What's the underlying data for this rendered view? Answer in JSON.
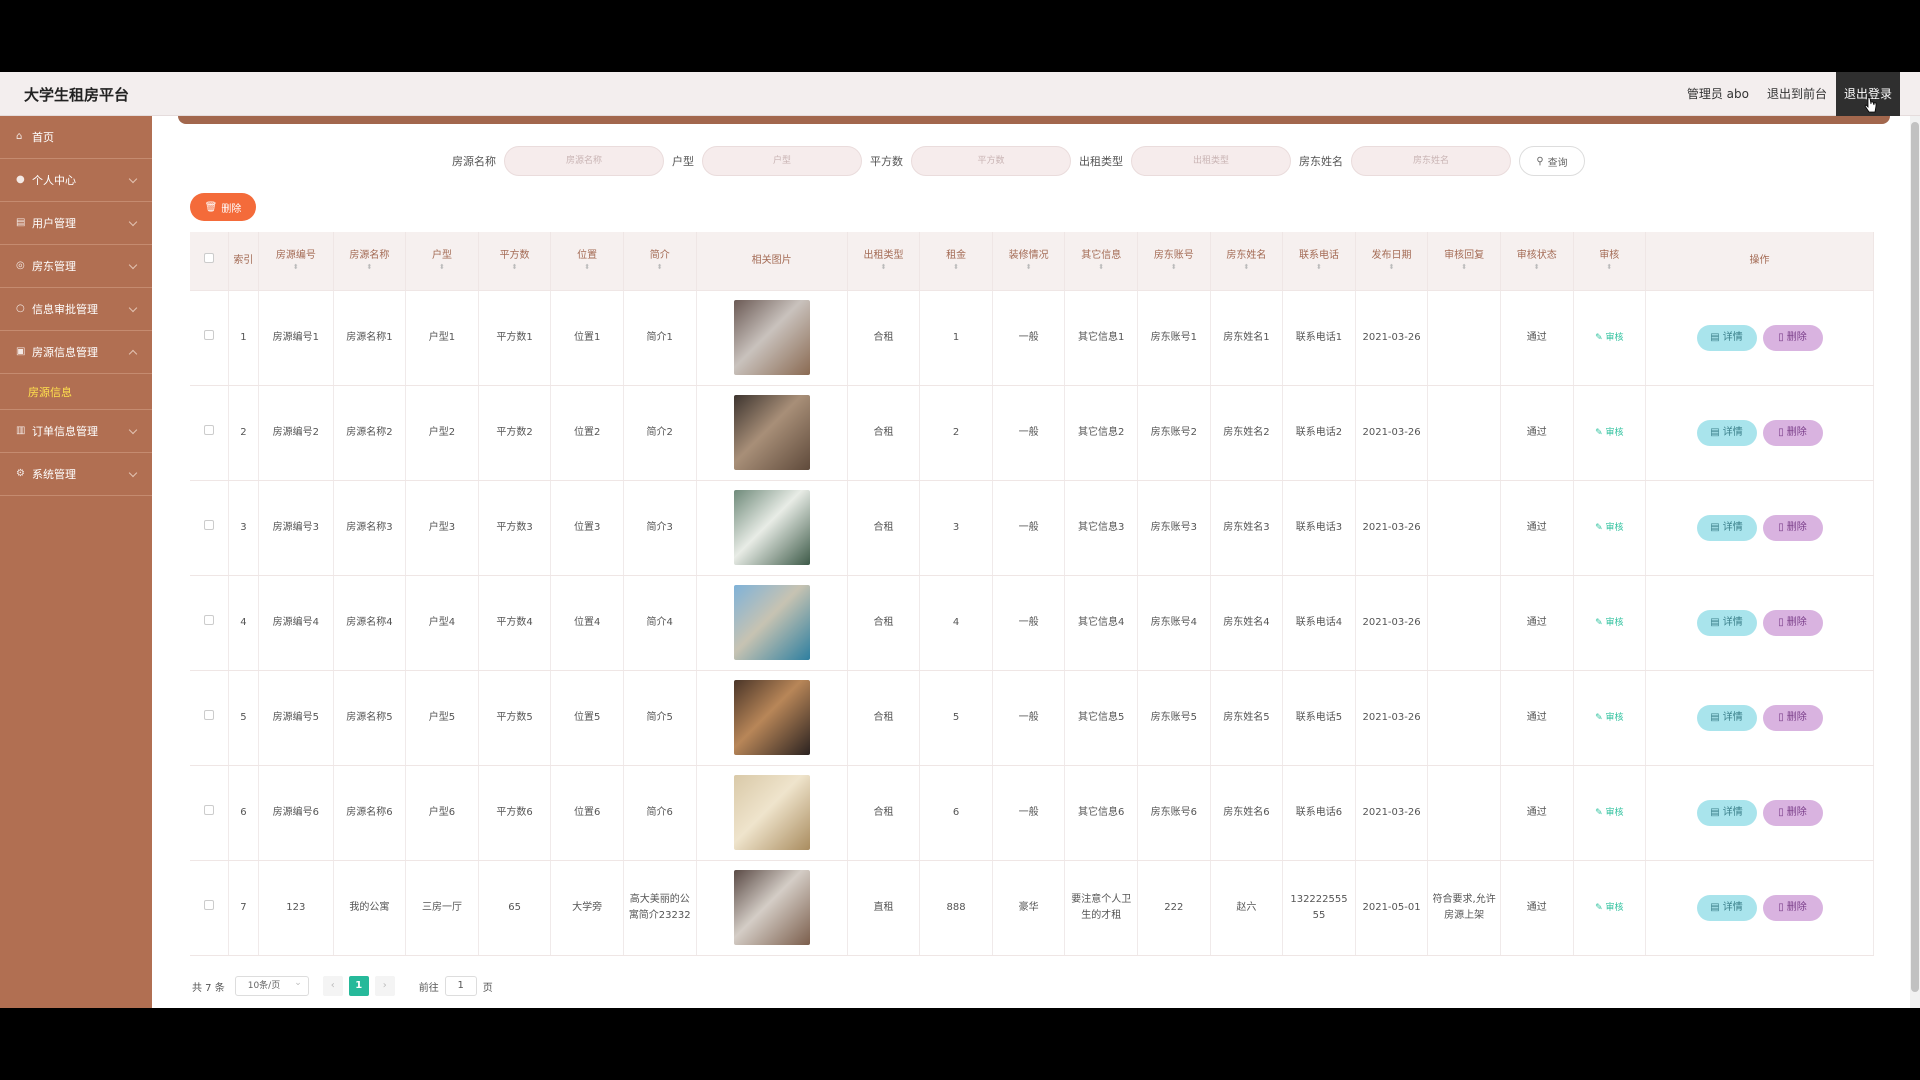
{
  "header": {
    "app_title": "大学生租房平台",
    "user_label": "管理员 abo",
    "back_front": "退出到前台",
    "logout": "退出登录"
  },
  "sidebar": {
    "items": [
      {
        "label": "首页",
        "icon": "home-icon"
      },
      {
        "label": "个人中心",
        "icon": "user-icon"
      },
      {
        "label": "用户管理",
        "icon": "users-icon"
      },
      {
        "label": "房东管理",
        "icon": "landlord-icon"
      },
      {
        "label": "信息审批管理",
        "icon": "approve-icon"
      },
      {
        "label": "房源信息管理",
        "icon": "house-icon"
      },
      {
        "label": "订单信息管理",
        "icon": "order-icon"
      },
      {
        "label": "系统管理",
        "icon": "gear-icon"
      }
    ],
    "active_sub": "房源信息"
  },
  "search": {
    "fields": [
      {
        "label": "房源名称",
        "placeholder": "房源名称"
      },
      {
        "label": "户型",
        "placeholder": "户型"
      },
      {
        "label": "平方数",
        "placeholder": "平方数"
      },
      {
        "label": "出租类型",
        "placeholder": "出租类型"
      },
      {
        "label": "房东姓名",
        "placeholder": "房东姓名"
      }
    ],
    "query_label": "查询"
  },
  "toolbar": {
    "delete_label": "删除"
  },
  "table": {
    "headers": [
      "索引",
      "房源编号",
      "房源名称",
      "户型",
      "平方数",
      "位置",
      "简介",
      "相关图片",
      "出租类型",
      "租金",
      "装修情况",
      "其它信息",
      "房东账号",
      "房东姓名",
      "联系电话",
      "发布日期",
      "审核回复",
      "审核状态",
      "审核",
      "操作"
    ],
    "rows": [
      {
        "idx": "1",
        "code": "房源编号1",
        "name": "房源名称1",
        "type": "户型1",
        "area": "平方数1",
        "loc": "位置1",
        "intro": "简介1",
        "rent_type": "合租",
        "rent": "1",
        "deco": "一般",
        "other": "其它信息1",
        "acct": "房东账号1",
        "owner": "房东姓名1",
        "phone": "联系电话1",
        "date": "2021-03-26",
        "reply": "",
        "status": "通过",
        "audit": "审核",
        "detail": "详情",
        "del": "删除",
        "img_colors": [
          "#6b5a55",
          "#c9c2bd",
          "#8a6a52"
        ]
      },
      {
        "idx": "2",
        "code": "房源编号2",
        "name": "房源名称2",
        "type": "户型2",
        "area": "平方数2",
        "loc": "位置2",
        "intro": "简介2",
        "rent_type": "合租",
        "rent": "2",
        "deco": "一般",
        "other": "其它信息2",
        "acct": "房东账号2",
        "owner": "房东姓名2",
        "phone": "联系电话2",
        "date": "2021-03-26",
        "reply": "",
        "status": "通过",
        "audit": "审核",
        "detail": "详情",
        "del": "删除",
        "img_colors": [
          "#3d342f",
          "#a88f78",
          "#5f4a3b"
        ]
      },
      {
        "idx": "3",
        "code": "房源编号3",
        "name": "房源名称3",
        "type": "户型3",
        "area": "平方数3",
        "loc": "位置3",
        "intro": "简介3",
        "rent_type": "合租",
        "rent": "3",
        "deco": "一般",
        "other": "其它信息3",
        "acct": "房东账号3",
        "owner": "房东姓名3",
        "phone": "联系电话3",
        "date": "2021-03-26",
        "reply": "",
        "status": "通过",
        "audit": "审核",
        "detail": "详情",
        "del": "删除",
        "img_colors": [
          "#6f8a7a",
          "#e8ece6",
          "#3d5a48"
        ]
      },
      {
        "idx": "4",
        "code": "房源编号4",
        "name": "房源名称4",
        "type": "户型4",
        "area": "平方数4",
        "loc": "位置4",
        "intro": "简介4",
        "rent_type": "合租",
        "rent": "4",
        "deco": "一般",
        "other": "其它信息4",
        "acct": "房东账号4",
        "owner": "房东姓名4",
        "phone": "联系电话4",
        "date": "2021-03-26",
        "reply": "",
        "status": "通过",
        "audit": "审核",
        "detail": "详情",
        "del": "删除",
        "img_colors": [
          "#7fb2d8",
          "#c7c3b2",
          "#2e7fa0"
        ]
      },
      {
        "idx": "5",
        "code": "房源编号5",
        "name": "房源名称5",
        "type": "户型5",
        "area": "平方数5",
        "loc": "位置5",
        "intro": "简介5",
        "rent_type": "合租",
        "rent": "5",
        "deco": "一般",
        "other": "其它信息5",
        "acct": "房东账号5",
        "owner": "房东姓名5",
        "phone": "联系电话5",
        "date": "2021-03-26",
        "reply": "",
        "status": "通过",
        "audit": "审核",
        "detail": "详情",
        "del": "删除",
        "img_colors": [
          "#4a3528",
          "#b88658",
          "#2b2220"
        ]
      },
      {
        "idx": "6",
        "code": "房源编号6",
        "name": "房源名称6",
        "type": "户型6",
        "area": "平方数6",
        "loc": "位置6",
        "intro": "简介6",
        "rent_type": "合租",
        "rent": "6",
        "deco": "一般",
        "other": "其它信息6",
        "acct": "房东账号6",
        "owner": "房东姓名6",
        "phone": "联系电话6",
        "date": "2021-03-26",
        "reply": "",
        "status": "通过",
        "audit": "审核",
        "detail": "详情",
        "del": "删除",
        "img_colors": [
          "#d9c9a8",
          "#efe4cc",
          "#a98c5f"
        ]
      },
      {
        "idx": "7",
        "code": "123",
        "name": "我的公寓",
        "type": "三房一厅",
        "area": "65",
        "loc": "大学旁",
        "intro": "高大美丽的公寓简介23232",
        "rent_type": "直租",
        "rent": "888",
        "deco": "豪华",
        "other": "要注意个人卫生的才租",
        "acct": "222",
        "owner": "赵六",
        "phone": "13222255555",
        "date": "2021-05-01",
        "reply": "符合要求,允许房源上架",
        "status": "通过",
        "audit": "审核",
        "detail": "详情",
        "del": "删除",
        "img_colors": [
          "#5a4a45",
          "#d4cdc6",
          "#7b5e4c"
        ]
      }
    ]
  },
  "pager": {
    "total": "共 7 条",
    "page_size": "10条/页",
    "current": "1",
    "goto_label": "前往",
    "goto_value": "1",
    "page_suffix": "页"
  }
}
